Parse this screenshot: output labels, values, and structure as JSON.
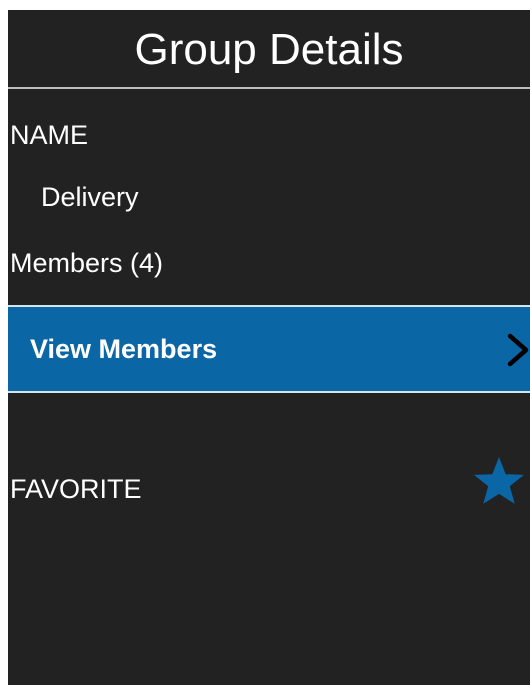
{
  "header": {
    "title": "Group Details"
  },
  "group": {
    "name_label": "NAME",
    "name_value": "Delivery",
    "members_label": "Members (4)",
    "view_members_label": "View Members",
    "favorite_label": "FAVORITE"
  },
  "icons": {
    "chevron": "chevron-right-icon",
    "favorite": "star-icon"
  },
  "colors": {
    "background": "#222222",
    "accent": "#0a66a5",
    "text": "#ffffff"
  }
}
